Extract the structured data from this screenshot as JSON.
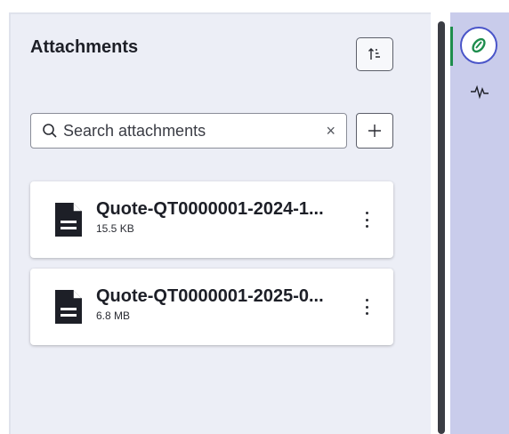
{
  "panel": {
    "title": "Attachments"
  },
  "search": {
    "placeholder": "Search attachments",
    "value": "",
    "clear_label": "×"
  },
  "attachments": [
    {
      "name": "Quote-QT0000001-2024-1...",
      "size": "15.5 KB"
    },
    {
      "name": "Quote-QT0000001-2025-0...",
      "size": "6.8 MB"
    }
  ],
  "colors": {
    "panel_bg": "#eceef6",
    "rail_bg": "#c9cceb",
    "accent_green": "#1e8d4d",
    "accent_blue": "#4a55c9"
  },
  "icons": {
    "sort": "sort-icon",
    "search": "search-icon",
    "clear": "close-icon",
    "add": "plus-icon",
    "file": "document-icon",
    "more": "kebab-menu-icon",
    "rail_attach": "paperclip-icon",
    "rail_activity": "activity-pulse-icon"
  }
}
